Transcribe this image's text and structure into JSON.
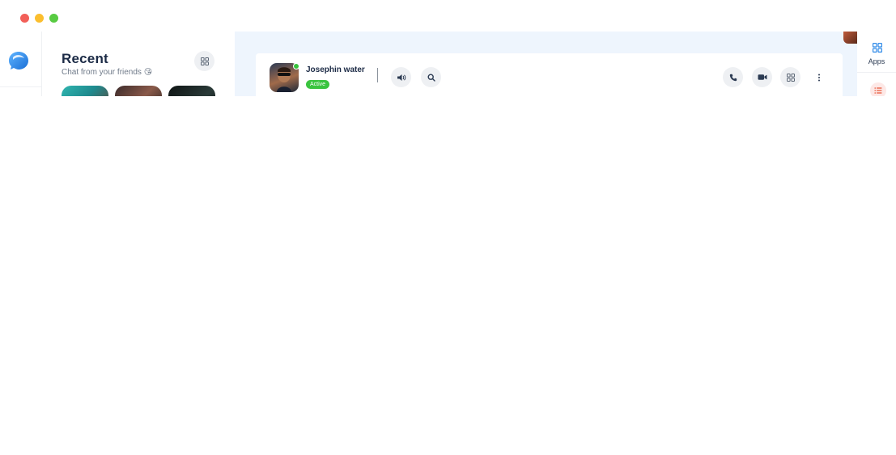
{
  "window": {
    "controls": [
      "close",
      "minimize",
      "maximize"
    ]
  },
  "rail": {
    "logo_icon": "chat-bubble-logo-icon"
  },
  "recent": {
    "title": "Recent",
    "subtitle": "Chat from your friends 😘",
    "grid_icon": "grid-icon",
    "stories": [
      "story-1",
      "story-2",
      "story-3"
    ]
  },
  "chat": {
    "contact": {
      "name": "Josephin water",
      "status": "Active",
      "online": true
    },
    "left_actions": [
      "speaker-icon",
      "search-icon"
    ],
    "right_actions": [
      "phone-icon",
      "video-icon",
      "grid-icon",
      "more-vertical-icon"
    ]
  },
  "right_rail": {
    "apps_label": "Apps",
    "apps_icon": "apps-grid-icon",
    "list_icon": "list-icon"
  },
  "colors": {
    "accent": "#2f8ae8",
    "active_green": "#3ac43f",
    "chat_bg": "#eef5fd",
    "title_text": "#1c2b46",
    "list_icon_red": "#e8583a"
  }
}
